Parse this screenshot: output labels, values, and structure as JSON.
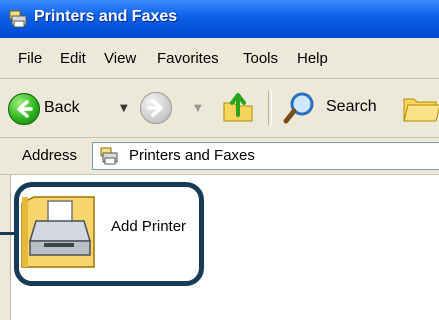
{
  "window": {
    "title": "Printers and Faxes"
  },
  "menubar": {
    "items": [
      "File",
      "Edit",
      "View",
      "Favorites",
      "Tools",
      "Help"
    ]
  },
  "toolbar": {
    "back_label": "Back",
    "search_label": "Search"
  },
  "address": {
    "label": "Address",
    "value": "Printers and Faxes"
  },
  "content": {
    "items": [
      {
        "label": "Add Printer",
        "icon": "add-printer-icon"
      }
    ]
  },
  "colors": {
    "titlebar": "#0a5fe6",
    "menubar_bg": "#ece9d8",
    "highlight": "#163b57"
  }
}
